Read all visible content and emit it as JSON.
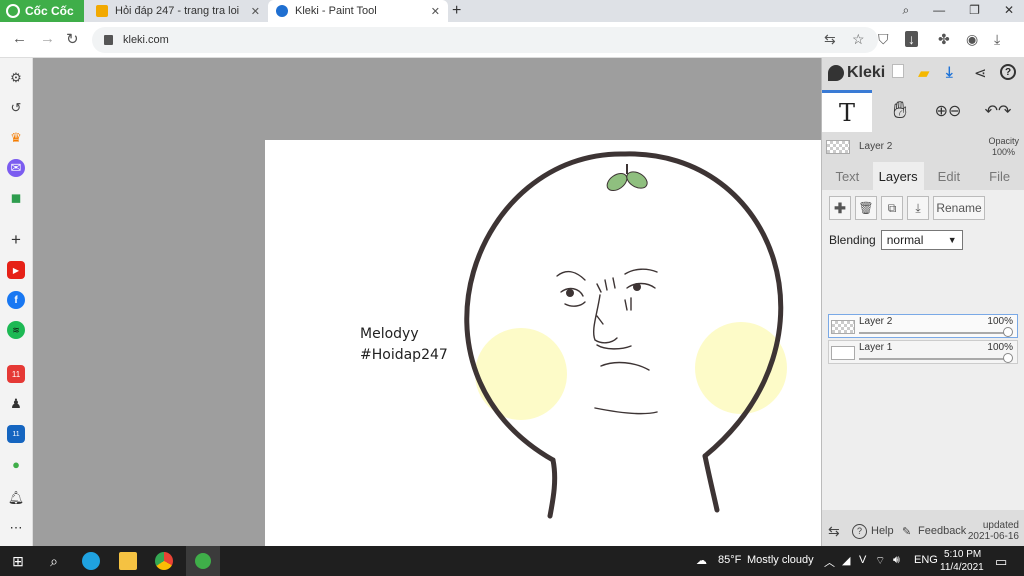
{
  "browser": {
    "brand": "Cốc Cốc",
    "tabs": [
      {
        "title": "Hỏi đáp 247 - trang tra loi",
        "active": false
      },
      {
        "title": "Kleki - Paint Tool",
        "active": true
      }
    ],
    "url": "kleki.com"
  },
  "canvas": {
    "text_line1": "Melodyy",
    "text_line2": "#Hoidap247"
  },
  "kleki": {
    "title": "Kleki",
    "current_layer": "Layer 2",
    "opacity_label": "Opacity",
    "opacity_value": "100%",
    "tabs": [
      "Text",
      "Layers",
      "Edit",
      "File"
    ],
    "active_tab": "Layers",
    "rename_label": "Rename",
    "blending_label": "Blending",
    "blending_value": "normal",
    "layers": [
      {
        "name": "Layer 2",
        "opacity": "100%",
        "active": true
      },
      {
        "name": "Layer 1",
        "opacity": "100%",
        "active": false
      }
    ],
    "footer": {
      "help": "Help",
      "feedback": "Feedback",
      "updated_line1": "updated",
      "updated_line2": "2021-06-16"
    }
  },
  "taskbar": {
    "weather_temp": "85°F",
    "weather_desc": "Mostly cloudy",
    "lang": "ENG",
    "time": "5:10 PM",
    "date": "11/4/2021"
  },
  "colors": {
    "brand_green": "#3fae49",
    "accent_blue": "#3a7bd5",
    "cheek_yellow": "#fdfbc8",
    "outline": "#3d3434",
    "leaf_green": "#8fbf7f"
  }
}
